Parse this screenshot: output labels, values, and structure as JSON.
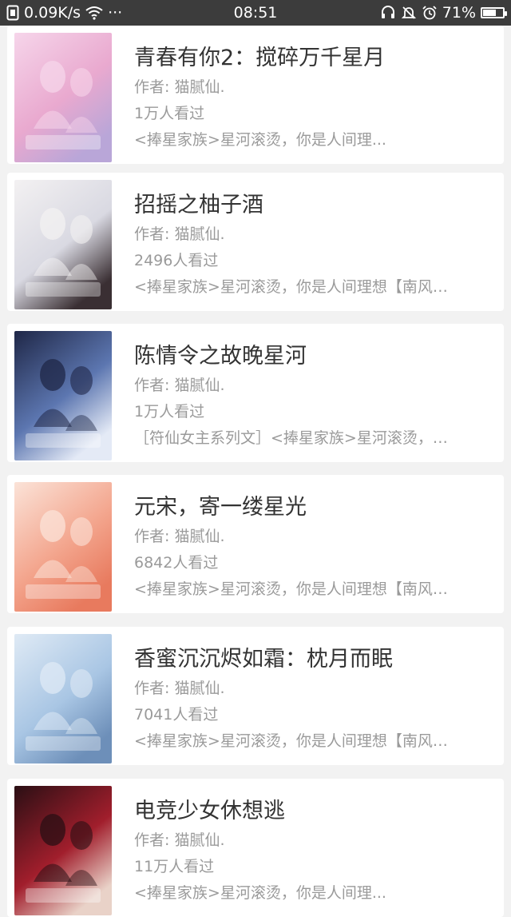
{
  "status_bar": {
    "speed": "0.09K/s",
    "more": "···",
    "time": "08:51",
    "battery_percent": "71%",
    "battery_level": 0.71,
    "icons": [
      "sim-icon",
      "wifi-icon",
      "headset-icon",
      "mute-icon",
      "alarm-icon",
      "battery-icon"
    ]
  },
  "books": [
    {
      "title": "青春有你2：搅碎万千星月",
      "author": "作者: 猫腻仙.",
      "views": "1万人看过",
      "desc": "<捧星家族>星河滚烫，你是人间理...",
      "cover_colors": [
        "#f6d5ea",
        "#e9a9cf",
        "#b9a6d8"
      ]
    },
    {
      "title": "招摇之柚子酒",
      "author": "作者: 猫腻仙.",
      "views": "2496人看过",
      "desc": "<捧星家族>星河滚烫，你是人间理想【南风…",
      "cover_colors": [
        "#f3f1f2",
        "#d9d9e2",
        "#3a2f33"
      ]
    },
    {
      "title": "陈情令之故晚星河",
      "author": "作者: 猫腻仙.",
      "views": "1万人看过",
      "desc": "［符仙女主系列文］<捧星家族>星河滚烫，…",
      "cover_colors": [
        "#1f2747",
        "#5c76b0",
        "#e4eaf6"
      ]
    },
    {
      "title": "元宋，寄一缕星光",
      "author": "作者: 猫腻仙.",
      "views": "6842人看过",
      "desc": "<捧星家族>星河滚烫，你是人间理想【南风…",
      "cover_colors": [
        "#fbe3d8",
        "#f3a48c",
        "#e87a5e"
      ]
    },
    {
      "title": "香蜜沉沉烬如霜：枕月而眠",
      "author": "作者: 猫腻仙.",
      "views": "7041人看过",
      "desc": "<捧星家族>星河滚烫，你是人间理想【南风…",
      "cover_colors": [
        "#dfeaf5",
        "#a9c6e4",
        "#6d8fb9"
      ]
    },
    {
      "title": "电竞少女休想逃",
      "author": "作者: 猫腻仙.",
      "views": "11万人看过",
      "desc": "<捧星家族>星河滚烫，你是人间理...",
      "cover_colors": [
        "#2a0f14",
        "#a11e2c",
        "#e9d2c8"
      ]
    }
  ]
}
